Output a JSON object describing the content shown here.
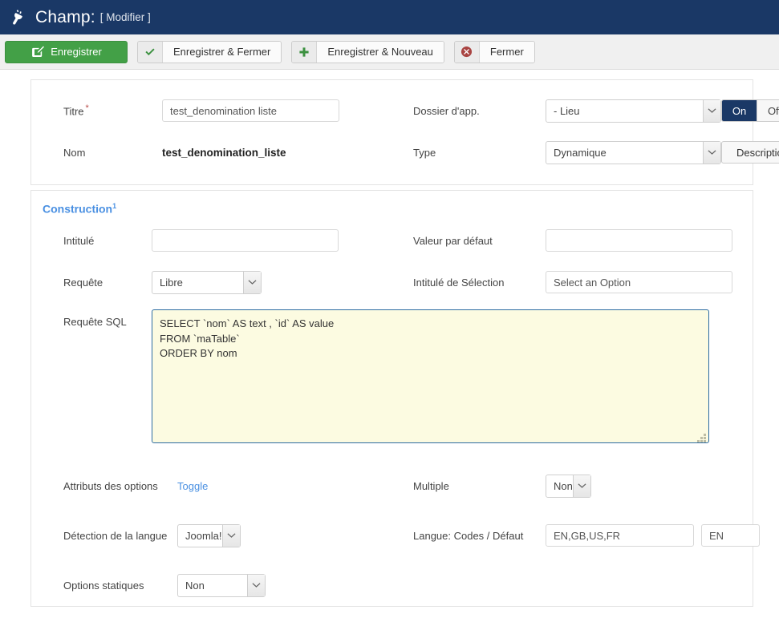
{
  "header": {
    "logo_icon": "plug-icon",
    "title": "Champ:",
    "subtitle": "[ Modifier ]"
  },
  "toolbar": {
    "save_label": "Enregistrer",
    "save_icon": "pencil-square-icon",
    "save_close_label": "Enregistrer & Fermer",
    "save_close_icon": "check-icon",
    "save_new_label": "Enregistrer & Nouveau",
    "save_new_icon": "plus-icon",
    "close_label": "Fermer",
    "close_icon": "circle-x-icon",
    "colors": {
      "primary_green": "#43a047",
      "check_green": "#3c9140",
      "close_red": "#a94442",
      "header_navy": "#1a3866"
    }
  },
  "basic_panel": {
    "titre": {
      "label": "Titre",
      "required_marker": "*",
      "value": "test_denomination liste"
    },
    "nom": {
      "label": "Nom",
      "value": "test_denomination_liste"
    },
    "dossier": {
      "label": "Dossier d'app.",
      "value": "- Lieu"
    },
    "type": {
      "label": "Type",
      "value": "Dynamique"
    },
    "published_toggle": {
      "on_label": "On",
      "off_label": "Off",
      "selected": "On"
    },
    "description_button": {
      "label": "Description"
    }
  },
  "construction_panel": {
    "tab_label": "Construction",
    "tab_superscript": "1",
    "intitule": {
      "label": "Intitulé",
      "value": "",
      "placeholder": ""
    },
    "valeur_defaut": {
      "label": "Valeur par défaut",
      "value": "",
      "placeholder": ""
    },
    "requete": {
      "label": "Requête",
      "value": "Libre"
    },
    "intitule_selection": {
      "label": "Intitulé de Sélection",
      "value": "Select an Option"
    },
    "requete_sql": {
      "label": "Requête SQL",
      "value": "SELECT `nom` AS text , `id` AS value\nFROM `maTable`\nORDER BY nom"
    },
    "attributs_options": {
      "label": "Attributs des options",
      "link_label": "Toggle"
    },
    "multiple": {
      "label": "Multiple",
      "value": "Non"
    },
    "detection_langue": {
      "label": "Détection de la langue",
      "value": "Joomla!"
    },
    "langue_codes": {
      "label": "Langue: Codes / Défaut",
      "codes_value": "EN,GB,US,FR",
      "default_value": "EN"
    },
    "options_statiques": {
      "label": "Options statiques",
      "value": "Non"
    }
  }
}
